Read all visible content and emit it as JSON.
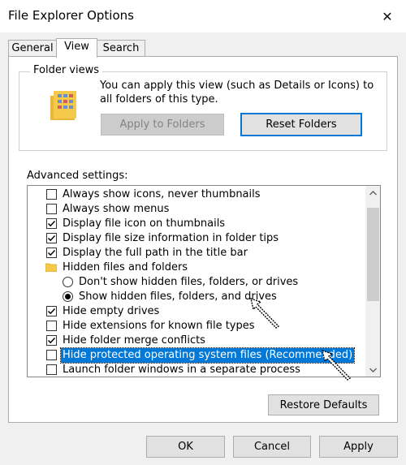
{
  "window": {
    "title": "File Explorer Options",
    "close_glyph": "✕"
  },
  "tabs": [
    {
      "label": "General",
      "active": false
    },
    {
      "label": "View",
      "active": true
    },
    {
      "label": "Search",
      "active": false
    }
  ],
  "folder_views": {
    "legend": "Folder views",
    "description": "You can apply this view (such as Details or Icons) to all folders of this type.",
    "apply_button": "Apply to Folders",
    "reset_button": "Reset Folders"
  },
  "advanced": {
    "label": "Advanced settings:",
    "items": [
      {
        "kind": "checkbox",
        "label": "Always show icons, never thumbnails",
        "checked": false,
        "indent": 1
      },
      {
        "kind": "checkbox",
        "label": "Always show menus",
        "checked": false,
        "indent": 1
      },
      {
        "kind": "checkbox",
        "label": "Display file icon on thumbnails",
        "checked": true,
        "indent": 1
      },
      {
        "kind": "checkbox",
        "label": "Display file size information in folder tips",
        "checked": true,
        "indent": 1
      },
      {
        "kind": "checkbox",
        "label": "Display the full path in the title bar",
        "checked": true,
        "indent": 1
      },
      {
        "kind": "folder",
        "label": "Hidden files and folders",
        "indent": 1
      },
      {
        "kind": "radio",
        "label": "Don't show hidden files, folders, or drives",
        "checked": false,
        "indent": 2
      },
      {
        "kind": "radio",
        "label": "Show hidden files, folders, and drives",
        "checked": true,
        "indent": 2
      },
      {
        "kind": "checkbox",
        "label": "Hide empty drives",
        "checked": true,
        "indent": 1
      },
      {
        "kind": "checkbox",
        "label": "Hide extensions for known file types",
        "checked": false,
        "indent": 1
      },
      {
        "kind": "checkbox",
        "label": "Hide folder merge conflicts",
        "checked": true,
        "indent": 1
      },
      {
        "kind": "checkbox",
        "label": "Hide protected operating system files (Recommended)",
        "checked": false,
        "indent": 1,
        "selected": true
      },
      {
        "kind": "checkbox",
        "label": "Launch folder windows in a separate process",
        "checked": false,
        "indent": 1
      }
    ]
  },
  "buttons": {
    "restore": "Restore Defaults",
    "ok": "OK",
    "cancel": "Cancel",
    "apply": "Apply"
  },
  "colors": {
    "accent": "#0078d7",
    "selection": "#0078d7",
    "folder_yellow": "#f5c94a"
  }
}
